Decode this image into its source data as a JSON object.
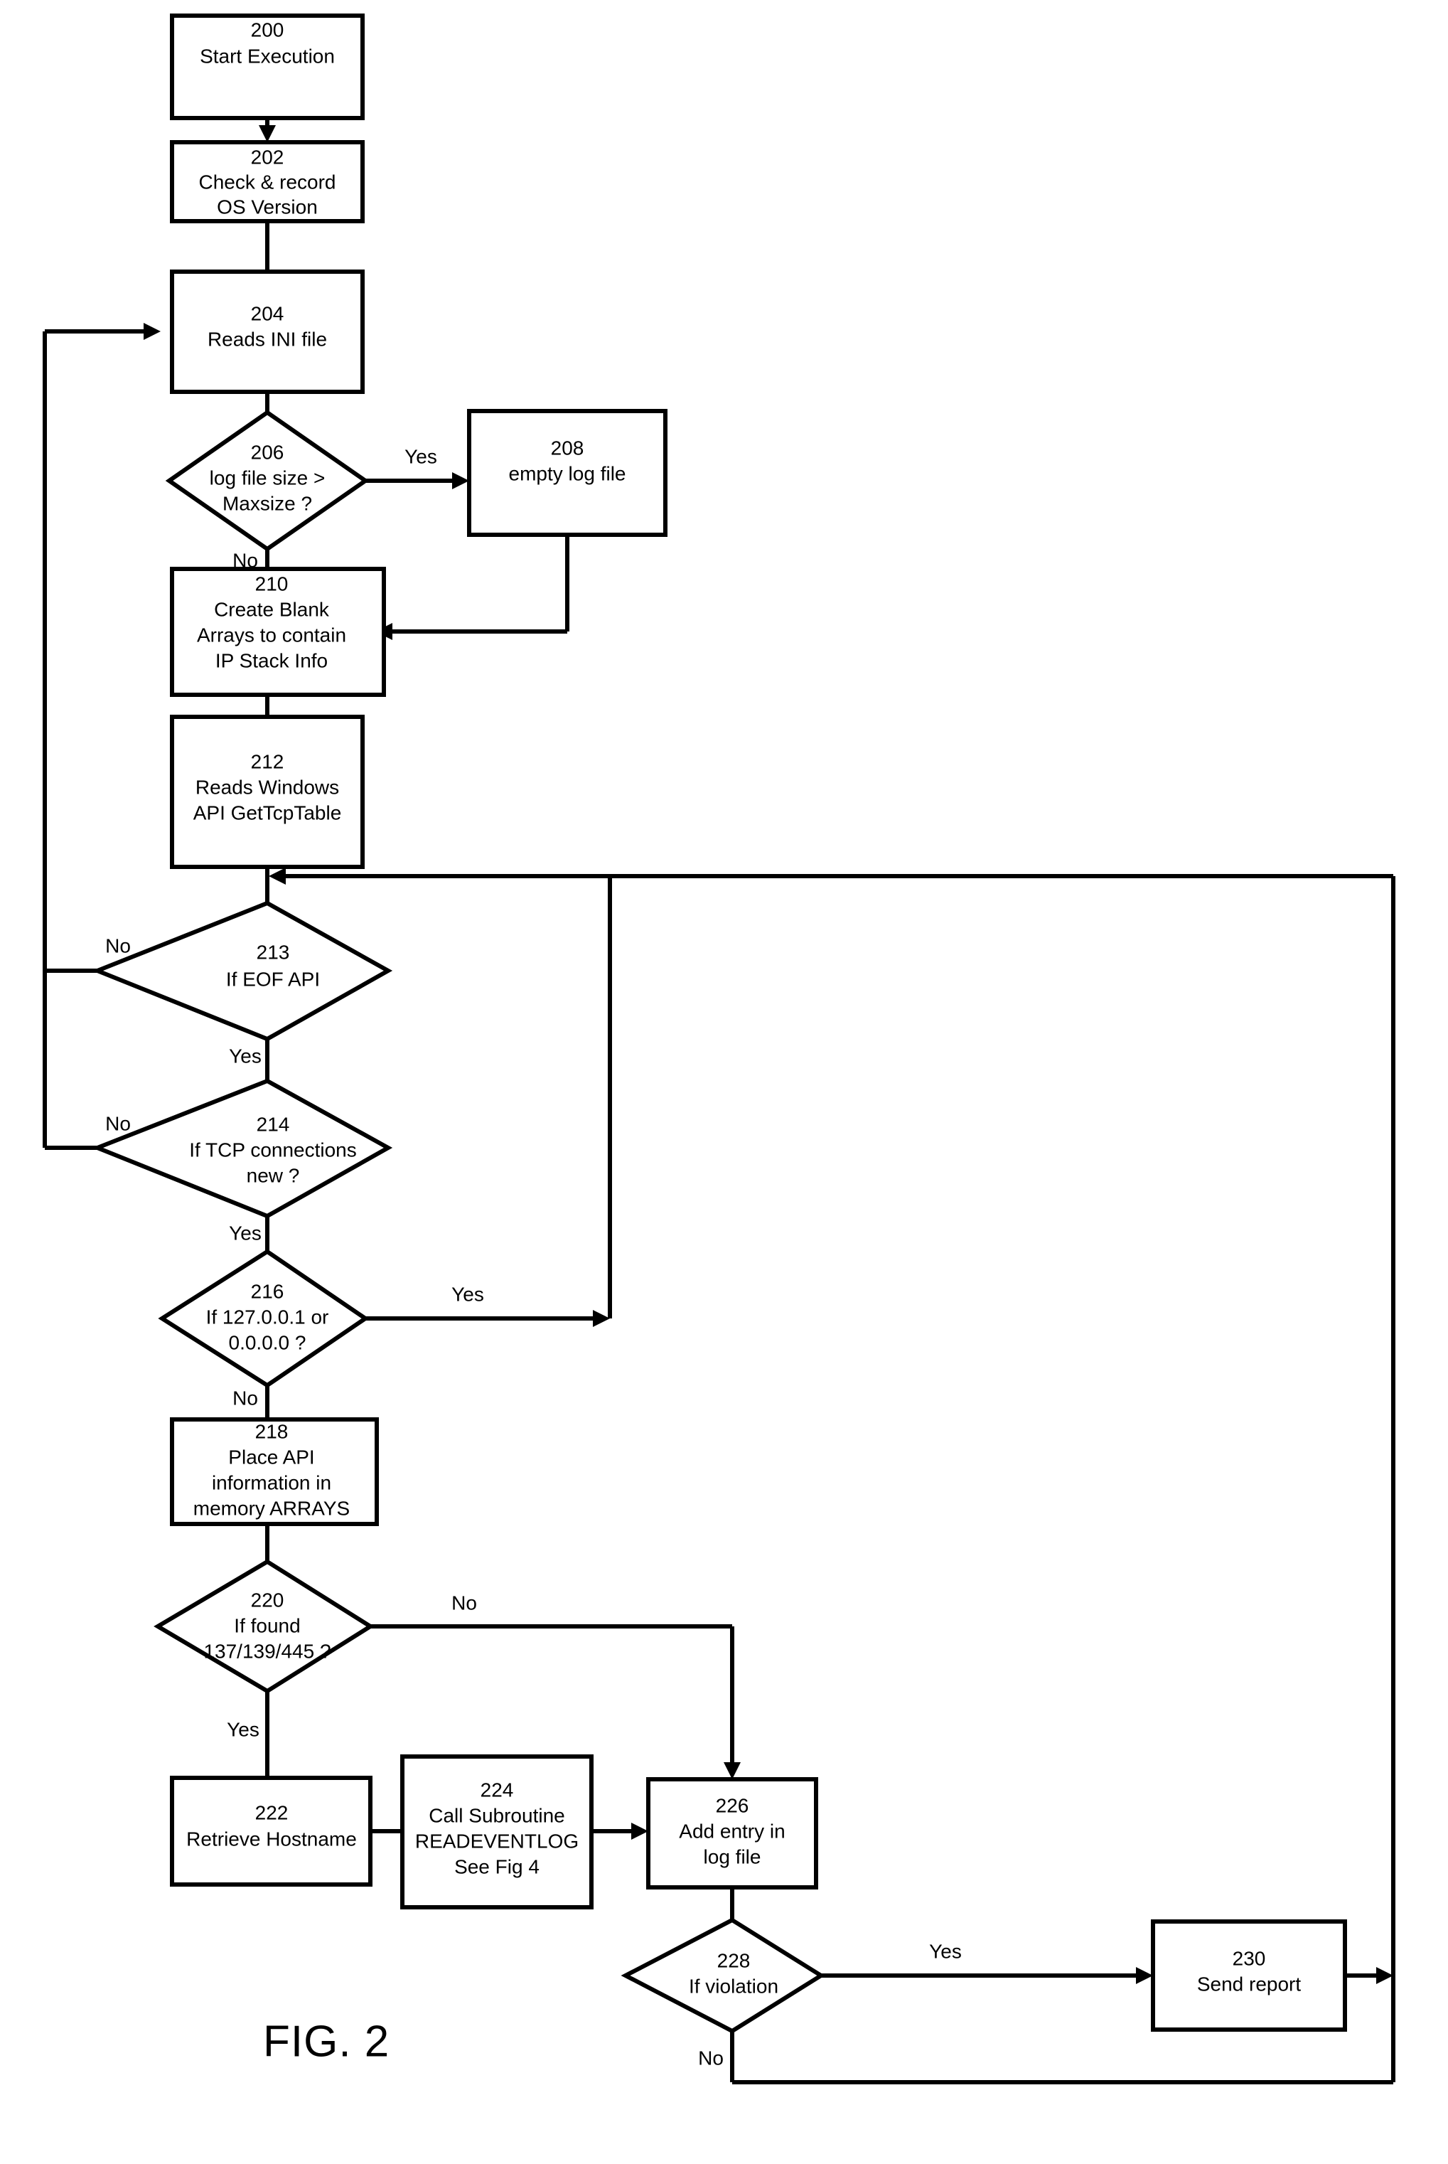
{
  "figure": {
    "label": "FIG. 2",
    "title": "FIG. 2"
  },
  "chart_data": {
    "type": "diagram",
    "title": "FIG. 2",
    "nodes": [
      {
        "id": "200",
        "shape": "process",
        "number": "200",
        "text": "Start Execution"
      },
      {
        "id": "202",
        "shape": "process",
        "number": "202",
        "text": "Check & record\nOS Version"
      },
      {
        "id": "204",
        "shape": "process",
        "number": "204",
        "text": "Reads INI file"
      },
      {
        "id": "206",
        "shape": "decision",
        "number": "206",
        "text": "log file  size  >\nMaxsize ?"
      },
      {
        "id": "208",
        "shape": "process",
        "number": "208",
        "text": "empty log file"
      },
      {
        "id": "210",
        "shape": "process",
        "number": "210",
        "text": "Create Blank\nArrays to contain\nIP Stack Info"
      },
      {
        "id": "212",
        "shape": "process",
        "number": "212",
        "text": "Reads Windows\nAPI GetTcpTable"
      },
      {
        "id": "213",
        "shape": "decision",
        "number": "213",
        "text": "If EOF API"
      },
      {
        "id": "214",
        "shape": "decision",
        "number": "214",
        "text": "If TCP connections\nnew ?"
      },
      {
        "id": "216",
        "shape": "decision",
        "number": "216",
        "text": "If 127.0.0.1 or\n0.0.0.0 ?"
      },
      {
        "id": "218",
        "shape": "process",
        "number": "218",
        "text": "Place API\ninformation in\nmemory ARRAYS"
      },
      {
        "id": "220",
        "shape": "decision",
        "number": "220",
        "text": "If found\n137/139/445 ?"
      },
      {
        "id": "222",
        "shape": "process",
        "number": "222",
        "text": "Retrieve Hostname"
      },
      {
        "id": "224",
        "shape": "process",
        "number": "224",
        "text": "Call Subroutine\nREADEVENTLOG\nSee Fig 4"
      },
      {
        "id": "226",
        "shape": "process",
        "number": "226",
        "text": "Add entry in\nlog file"
      },
      {
        "id": "228",
        "shape": "decision",
        "number": "228",
        "text": "If violation"
      },
      {
        "id": "230",
        "shape": "process",
        "number": "230",
        "text": "Send report"
      }
    ],
    "edges": [
      {
        "from": "200",
        "to": "202",
        "label": ""
      },
      {
        "from": "202",
        "to": "204",
        "label": ""
      },
      {
        "from": "204",
        "to": "206",
        "label": ""
      },
      {
        "from": "206",
        "to": "208",
        "label": "Yes"
      },
      {
        "from": "206",
        "to": "210",
        "label": "No"
      },
      {
        "from": "208",
        "to": "210",
        "label": ""
      },
      {
        "from": "210",
        "to": "212",
        "label": ""
      },
      {
        "from": "212",
        "to": "213",
        "label": ""
      },
      {
        "from": "213",
        "to": "204",
        "label": "No"
      },
      {
        "from": "213",
        "to": "214",
        "label": "Yes"
      },
      {
        "from": "214",
        "to": "204",
        "label": "No"
      },
      {
        "from": "214",
        "to": "216",
        "label": "Yes"
      },
      {
        "from": "216",
        "to": "212",
        "label": "Yes"
      },
      {
        "from": "216",
        "to": "218",
        "label": "No"
      },
      {
        "from": "218",
        "to": "220",
        "label": ""
      },
      {
        "from": "220",
        "to": "226",
        "label": "No"
      },
      {
        "from": "220",
        "to": "222",
        "label": "Yes"
      },
      {
        "from": "222",
        "to": "224",
        "label": ""
      },
      {
        "from": "224",
        "to": "226",
        "label": ""
      },
      {
        "from": "226",
        "to": "228",
        "label": ""
      },
      {
        "from": "228",
        "to": "230",
        "label": "Yes"
      },
      {
        "from": "228",
        "to": "212",
        "label": "No"
      },
      {
        "from": "230",
        "to": "212",
        "label": ""
      }
    ]
  },
  "nodes": {
    "n200": {
      "number": "200",
      "line1": "Start Execution"
    },
    "n202": {
      "number": "202",
      "line1": "Check & record",
      "line2": "OS Version"
    },
    "n204": {
      "number": "204",
      "line1": "Reads INI file"
    },
    "n206": {
      "number": "206",
      "line1": "log file  size  >",
      "line2": "Maxsize ?"
    },
    "n208": {
      "number": "208",
      "line1": "empty log file"
    },
    "n210": {
      "number": "210",
      "line1": "Create Blank",
      "line2": "Arrays to contain",
      "line3": "IP Stack Info"
    },
    "n212": {
      "number": "212",
      "line1": "Reads Windows",
      "line2": "API GetTcpTable"
    },
    "n213": {
      "number": "213",
      "line1": "If EOF API"
    },
    "n214": {
      "number": "214",
      "line1": "If TCP connections",
      "line2": "new ?"
    },
    "n216": {
      "number": "216",
      "line1": "If 127.0.0.1 or",
      "line2": "0.0.0.0 ?"
    },
    "n218": {
      "number": "218",
      "line1": "Place API",
      "line2": "information in",
      "line3": "memory ARRAYS"
    },
    "n220": {
      "number": "220",
      "line1": "If found",
      "line2": "137/139/445 ?"
    },
    "n222": {
      "number": "222",
      "line1": "Retrieve Hostname"
    },
    "n224": {
      "number": "224",
      "line1": "Call Subroutine",
      "line2": "READEVENTLOG",
      "line3": "See Fig 4"
    },
    "n226": {
      "number": "226",
      "line1": "Add entry in",
      "line2": "log file"
    },
    "n228": {
      "number": "228",
      "line1": "If violation"
    },
    "n230": {
      "number": "230",
      "line1": "Send report"
    }
  },
  "edge_labels": {
    "e206_yes": "Yes",
    "e206_no": "No",
    "e213_no": "No",
    "e213_yes": "Yes",
    "e214_no": "No",
    "e214_yes": "Yes",
    "e216_yes": "Yes",
    "e216_no": "No",
    "e220_no": "No",
    "e220_yes": "Yes",
    "e228_yes": "Yes",
    "e228_no": "No"
  },
  "colors": {
    "stroke": "#000000",
    "fill": "#ffffff",
    "background": "#ffffff"
  }
}
